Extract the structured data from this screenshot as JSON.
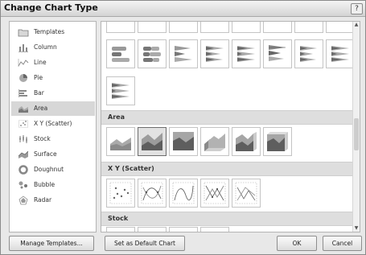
{
  "window": {
    "title": "Change Chart Type",
    "help_glyph": "?"
  },
  "categories": [
    {
      "label": "Templates",
      "icon": "folder-icon"
    },
    {
      "label": "Column",
      "icon": "column-chart-icon"
    },
    {
      "label": "Line",
      "icon": "line-chart-icon"
    },
    {
      "label": "Pie",
      "icon": "pie-chart-icon"
    },
    {
      "label": "Bar",
      "icon": "bar-chart-icon"
    },
    {
      "label": "Area",
      "icon": "area-chart-icon"
    },
    {
      "label": "X Y (Scatter)",
      "icon": "scatter-chart-icon"
    },
    {
      "label": "Stock",
      "icon": "stock-chart-icon"
    },
    {
      "label": "Surface",
      "icon": "surface-chart-icon"
    },
    {
      "label": "Doughnut",
      "icon": "doughnut-chart-icon"
    },
    {
      "label": "Bubble",
      "icon": "bubble-chart-icon"
    },
    {
      "label": "Radar",
      "icon": "radar-chart-icon"
    }
  ],
  "selected_category": "Area",
  "gallery": {
    "sections": [
      {
        "title": "Area"
      },
      {
        "title": "X Y (Scatter)"
      },
      {
        "title": "Stock"
      }
    ],
    "bar_thumbs": [
      "clustered-bar",
      "stacked-bar",
      "100%-stacked-bar",
      "clustered-cylinder-bar",
      "stacked-cylinder-bar",
      "clustered-cone-bar",
      "stacked-cone-bar",
      "clustered-pyramid-bar"
    ],
    "area_thumbs": [
      "area",
      "stacked-area",
      "100%-stacked-area",
      "3-d-area",
      "3-d-stacked-area",
      "3-d-100%-stacked-area"
    ],
    "scatter_thumbs": [
      "scatter-markers",
      "scatter-smooth-markers",
      "scatter-smooth-lines",
      "scatter-straight-markers",
      "scatter-straight-lines"
    ],
    "selected_thumb": "stacked-area"
  },
  "buttons": {
    "manage_templates": "Manage Templates...",
    "set_default": "Set as Default Chart",
    "ok": "OK",
    "cancel": "Cancel"
  },
  "colors": {
    "selected_bg": "#d7d7d7",
    "dialog_bg": "#e8e8e8",
    "icon_gray": "#888888"
  }
}
